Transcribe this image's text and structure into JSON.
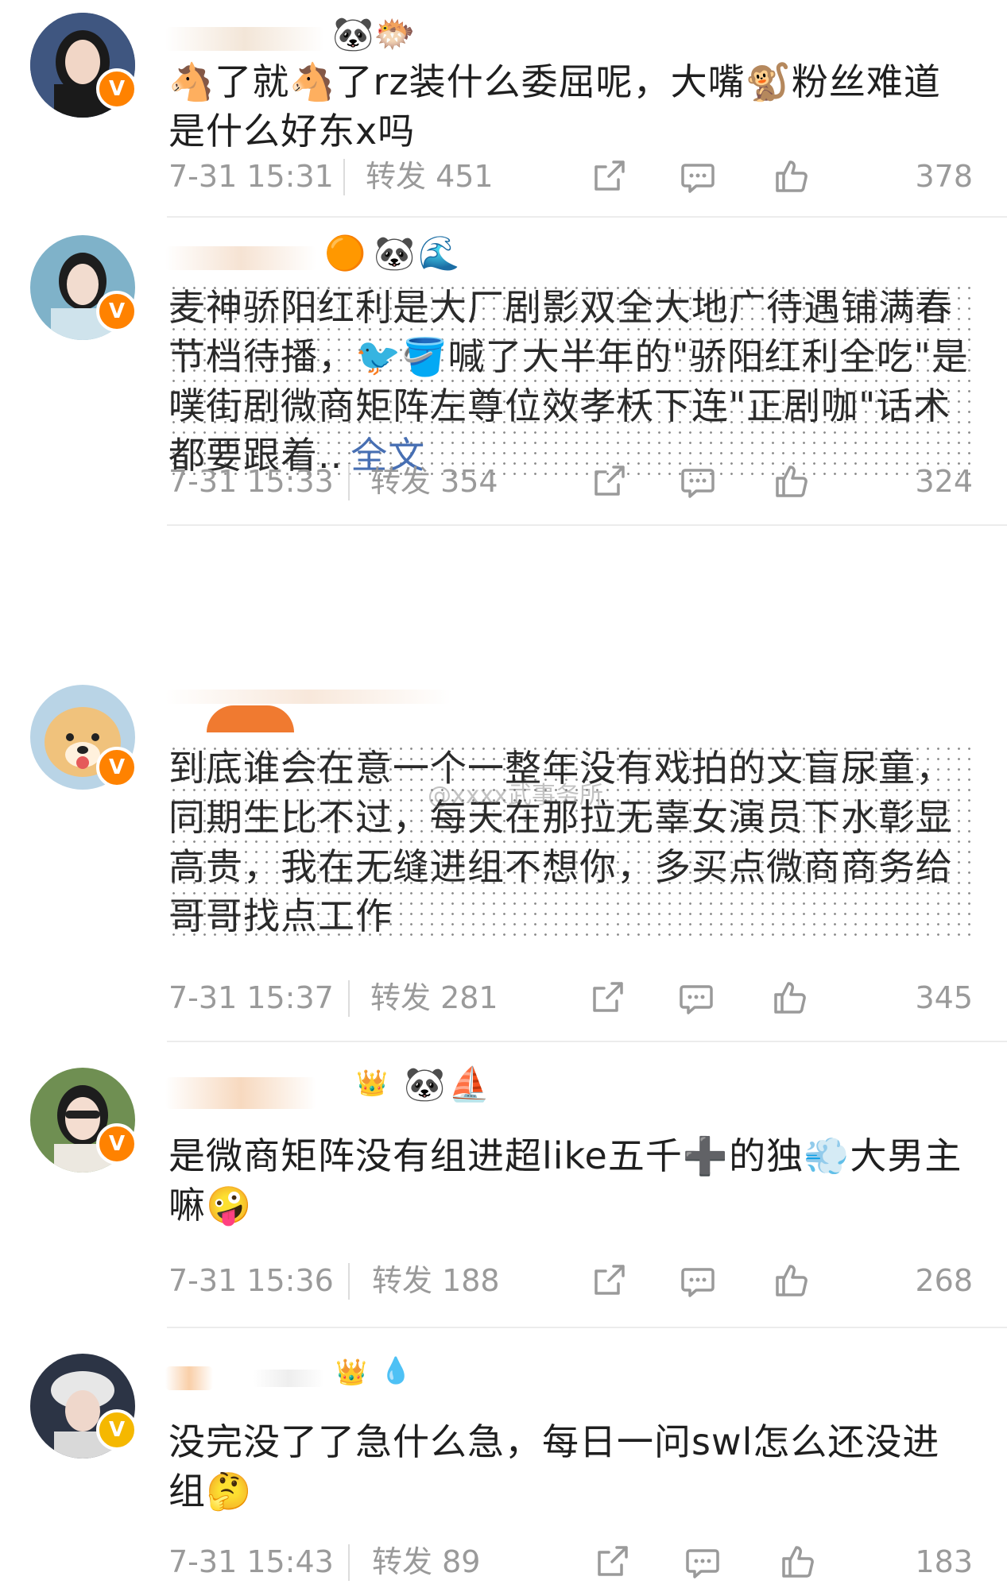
{
  "posts": [
    {
      "content": "🐴了就🐴了rz装什么委屈呢，大嘴🐒粉丝难道是什么好东x吗",
      "more": "",
      "time": "7-31 15:31",
      "repost": "转发 451",
      "likes": "378",
      "avatar_color": "#3b4b6a",
      "badge_color": "#ff8200"
    },
    {
      "content": "麦神骄阳红利是大厂剧影双全大地广待遇铺满春节档待播，🐦🪣喊了大半年的\"骄阳红利全吃\"是噗街剧微商矩阵左尊位效孝枖下连\"正剧咖\"话术都要跟着..",
      "more": "全文",
      "time": "7-31 15:33",
      "repost": "转发 354",
      "likes": "324",
      "avatar_color": "#7fb2c9",
      "badge_color": "#ff8200"
    },
    {
      "content": "到底谁会在意一个一整年没有戏拍的文盲尿童，同期生比不过，每天在那拉无辜女演员下水彰显高贵，我在无缝进组不想你，多买点微商商务给哥哥找点工作",
      "more": "",
      "time": "7-31 15:37",
      "repost": "转发 281",
      "likes": "345",
      "avatar_color": "#e8c48a",
      "badge_color": "#ff8200"
    },
    {
      "content": "是微商矩阵没有组进超like五千➕的独💨大男主嘛🤪",
      "more": "",
      "time": "7-31 15:36",
      "repost": "转发 188",
      "likes": "268",
      "avatar_color": "#5e7a4a",
      "badge_color": "#ff8200"
    },
    {
      "content": "没完没了了急什么急，每日一问swl怎么还没进组🤔",
      "more": "",
      "time": "7-31 15:43",
      "repost": "转发 89",
      "likes": "183",
      "avatar_color": "#2c3445",
      "badge_color": "#f5b800"
    }
  ],
  "watermark": "@xxxx武事务所",
  "icons": {
    "share": "share-icon",
    "comment": "comment-icon",
    "like": "thumbs-up-icon",
    "verified": "verified-v-icon"
  },
  "accent": "#476fb3",
  "verified_label": "V"
}
